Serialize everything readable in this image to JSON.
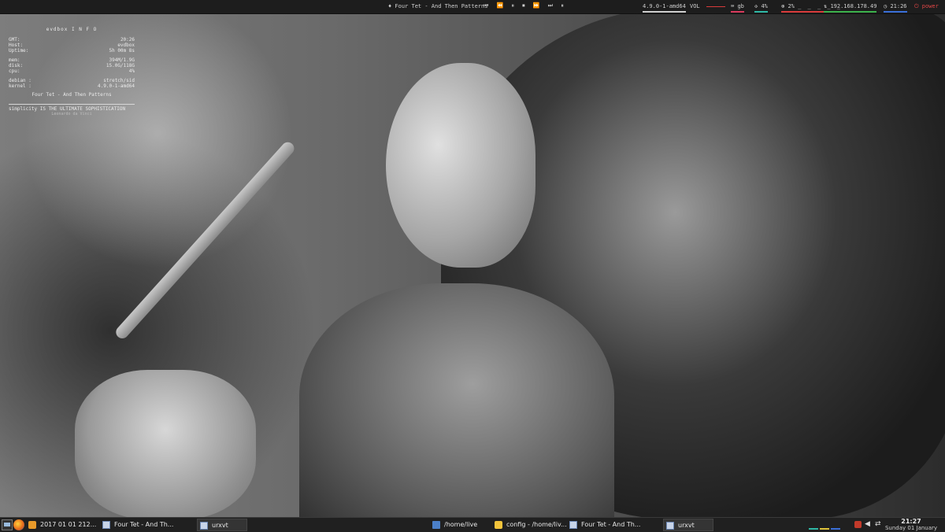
{
  "topbar": {
    "now_playing": "♦ Four Tet - And Then Patterns",
    "player_controls": "⏮ ⏪ ⏸ ⏹ ⏩ ⏭   ⏸",
    "modules": {
      "kernel": "4.9.0-1-amd64",
      "vol_label": "VOL",
      "lang": "gb",
      "cpu": "4%",
      "ram": "2%",
      "ip": "192.168.178.49",
      "time": "21:26",
      "power": "power"
    },
    "colors": {
      "kernel": "#cfcfcf",
      "vol": "#d93b3b",
      "lang": "#d83a5d",
      "cpu": "#2fb9a6",
      "ram": "#d93b3b",
      "ip": "#3cb24b",
      "time": "#3a6fd8",
      "power": "#e04646"
    }
  },
  "conky": {
    "title": "evdbox I N F O",
    "rows": [
      {
        "label": "GMT:",
        "value": "20:26"
      },
      {
        "label": "Host:",
        "value": "evdbox"
      },
      {
        "label": "Uptime:",
        "value": "5h 00m 8s"
      }
    ],
    "rows2": [
      {
        "label": "mem:",
        "value": "394M/1.9G"
      },
      {
        "label": "disk:",
        "value": "15.0G/118G"
      },
      {
        "label": "cpu:",
        "value": "4%"
      }
    ],
    "rows3": [
      {
        "label": "debian :",
        "value": "stretch/sid"
      },
      {
        "label": "kernel :",
        "value": "4.9.0-1-amd64"
      }
    ],
    "song": "Four Tet - And Then Patterns",
    "quote": "simplicity IS THE ULTIMATE SOPHISTICATION",
    "quote_author": "Leonardo da Vinci"
  },
  "taskbar": {
    "launchers": [
      "terminal-icon",
      "firefox-icon"
    ],
    "tasks": [
      {
        "label": "2017 01 01 212...",
        "icon": "image-viewer-icon"
      },
      {
        "label": "Four Tet - And Th...",
        "icon": "window-icon"
      },
      {
        "label": "urxvt",
        "icon": "terminal-window-icon"
      },
      {
        "label": "/home/live",
        "icon": "file-manager-icon"
      },
      {
        "label": "config - /home/liv...",
        "icon": "text-editor-icon"
      },
      {
        "label": "Four Tet - And Th...",
        "icon": "window-icon"
      },
      {
        "label": "urxvt",
        "icon": "terminal-window-icon"
      }
    ],
    "clock_time": "21:27",
    "clock_date": "Sunday 01 January"
  }
}
